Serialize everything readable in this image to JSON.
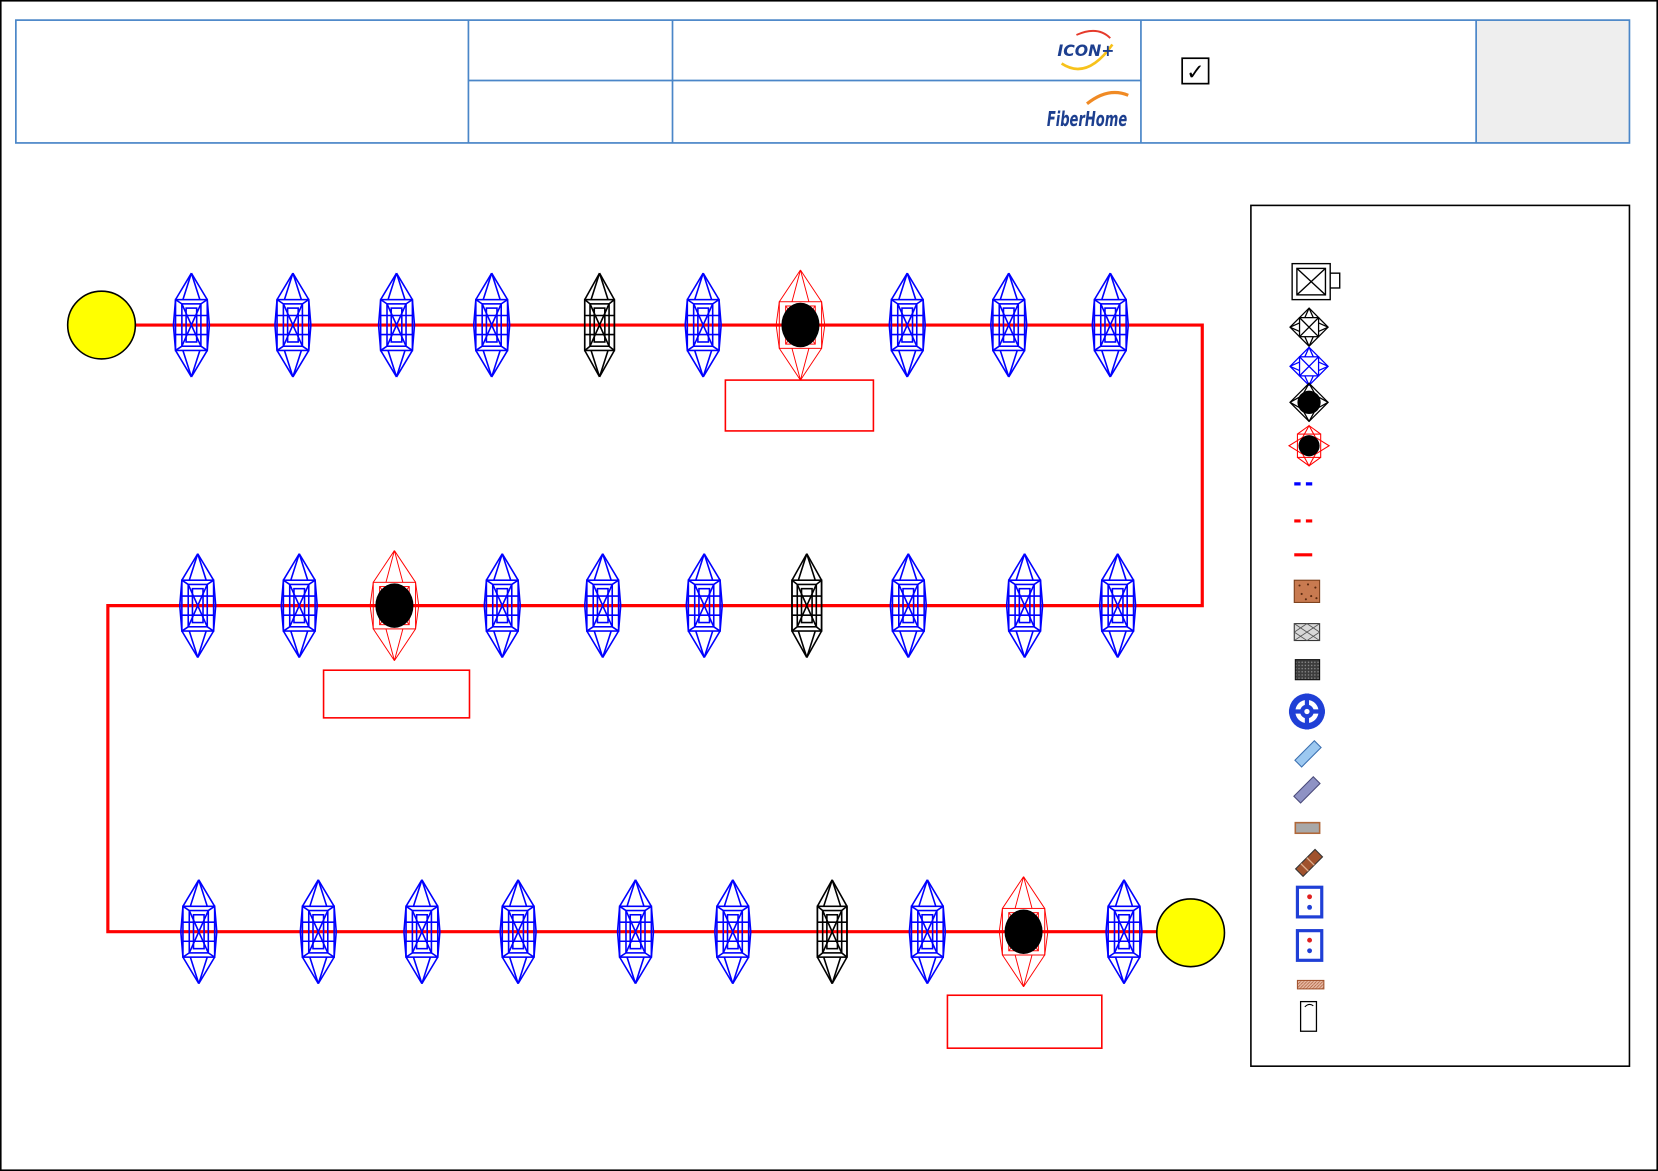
{
  "title_block": {
    "logo_icon_plus": "ICON+",
    "logo_fiberhome": "FiberHome",
    "checkbox_mark": "✓"
  },
  "colors": {
    "route_line": "#ff0000",
    "tower": "#0000ff",
    "tension_tower": "#000000",
    "joint_tower": "#ff0000",
    "joint_marker": "#000000",
    "terminal": "#ffff00",
    "label_box": "#ff0000",
    "title_block_border": "#4a86c8",
    "title_block_shaded_cell": "#eeeeee",
    "logo_blue": "#1d3f8f",
    "logo_orange": "#f08a24"
  },
  "route": {
    "start": "terminal-circle-icon",
    "end": "terminal-circle-icon",
    "rows": [
      [
        "tower-blue-icon",
        "tower-blue-icon",
        "tower-blue-icon",
        "tower-blue-icon",
        "tower-black-icon",
        "tower-blue-icon",
        "tower-joint-icon",
        "tower-blue-icon",
        "tower-blue-icon",
        "tower-blue-icon"
      ],
      [
        "tower-blue-icon",
        "tower-blue-icon",
        "tower-joint-icon",
        "tower-blue-icon",
        "tower-blue-icon",
        "tower-blue-icon",
        "tower-black-icon",
        "tower-blue-icon",
        "tower-blue-icon",
        "tower-blue-icon"
      ],
      [
        "tower-blue-icon",
        "tower-blue-icon",
        "tower-blue-icon",
        "tower-blue-icon",
        "tower-blue-icon",
        "tower-blue-icon",
        "tower-black-icon",
        "tower-blue-icon",
        "tower-joint-icon",
        "tower-blue-icon"
      ]
    ]
  },
  "legend": {
    "items": [
      "joint-box-icon",
      "tower-black-icon",
      "tower-blue-icon",
      "tower-black-joint-icon",
      "tower-red-joint-icon",
      "blue-dashed-line-icon",
      "red-dashed-line-icon",
      "red-solid-line-icon",
      "brown-dotted-box-icon",
      "gray-crosshatch-box-icon",
      "dark-dotted-box-icon",
      "blue-target-icon",
      "light-blue-strip-icon",
      "gray-blue-strip-icon",
      "gray-bar-icon",
      "brown-strip-icon",
      "blue-dotted-square-icon",
      "blue-dotted-square-icon",
      "brown-hatched-bar-icon",
      "white-post-icon"
    ]
  }
}
